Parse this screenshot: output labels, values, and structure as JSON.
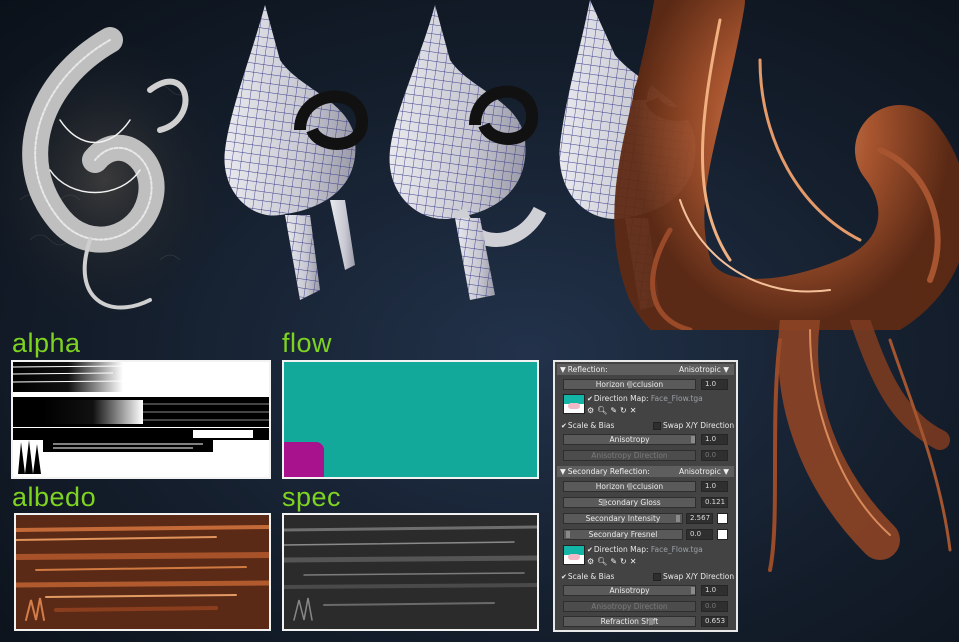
{
  "textures": {
    "alpha": "alpha",
    "flow": "flow",
    "albedo": "albedo",
    "spec": "spec"
  },
  "colors": {
    "label_green": "#7ed321",
    "flow_teal": "#12a89a",
    "flow_magenta": "#a8128c"
  },
  "reflection": {
    "title": "Reflection:",
    "mode": "Anisotropic",
    "horizon_occlusion_label": "Horizon Occlusion",
    "horizon_occlusion_value": "1.0",
    "direction_map_label": "Direction Map:",
    "direction_map_file": "Face_Flow.tga",
    "scale_bias_label": "Scale & Bias",
    "swap_label": "Swap X/Y Direction",
    "anisotropy_label": "Anisotropy",
    "anisotropy_value": "1.0",
    "anisotropy_direction_label": "Anisotropy Direction",
    "anisotropy_direction_value": "0.0"
  },
  "secondary": {
    "title": "Secondary Reflection:",
    "mode": "Anisotropic",
    "horizon_occlusion_label": "Horizon Occlusion",
    "horizon_occlusion_value": "1.0",
    "gloss_label": "Secondary Gloss",
    "gloss_value": "0.121",
    "intensity_label": "Secondary Intensity",
    "intensity_value": "2.567",
    "fresnel_label": "Secondary Fresnel",
    "fresnel_value": "0.0",
    "direction_map_label": "Direction Map:",
    "direction_map_file": "Face_Flow.tga",
    "scale_bias_label": "Scale & Bias",
    "swap_label": "Swap X/Y Direction",
    "anisotropy_label": "Anisotropy",
    "anisotropy_value": "1.0",
    "anisotropy_direction_label": "Anisotropy Direction",
    "anisotropy_direction_value": "0.0",
    "refraction_shift_label": "Refraction Shift",
    "refraction_shift_value": "0.653"
  }
}
